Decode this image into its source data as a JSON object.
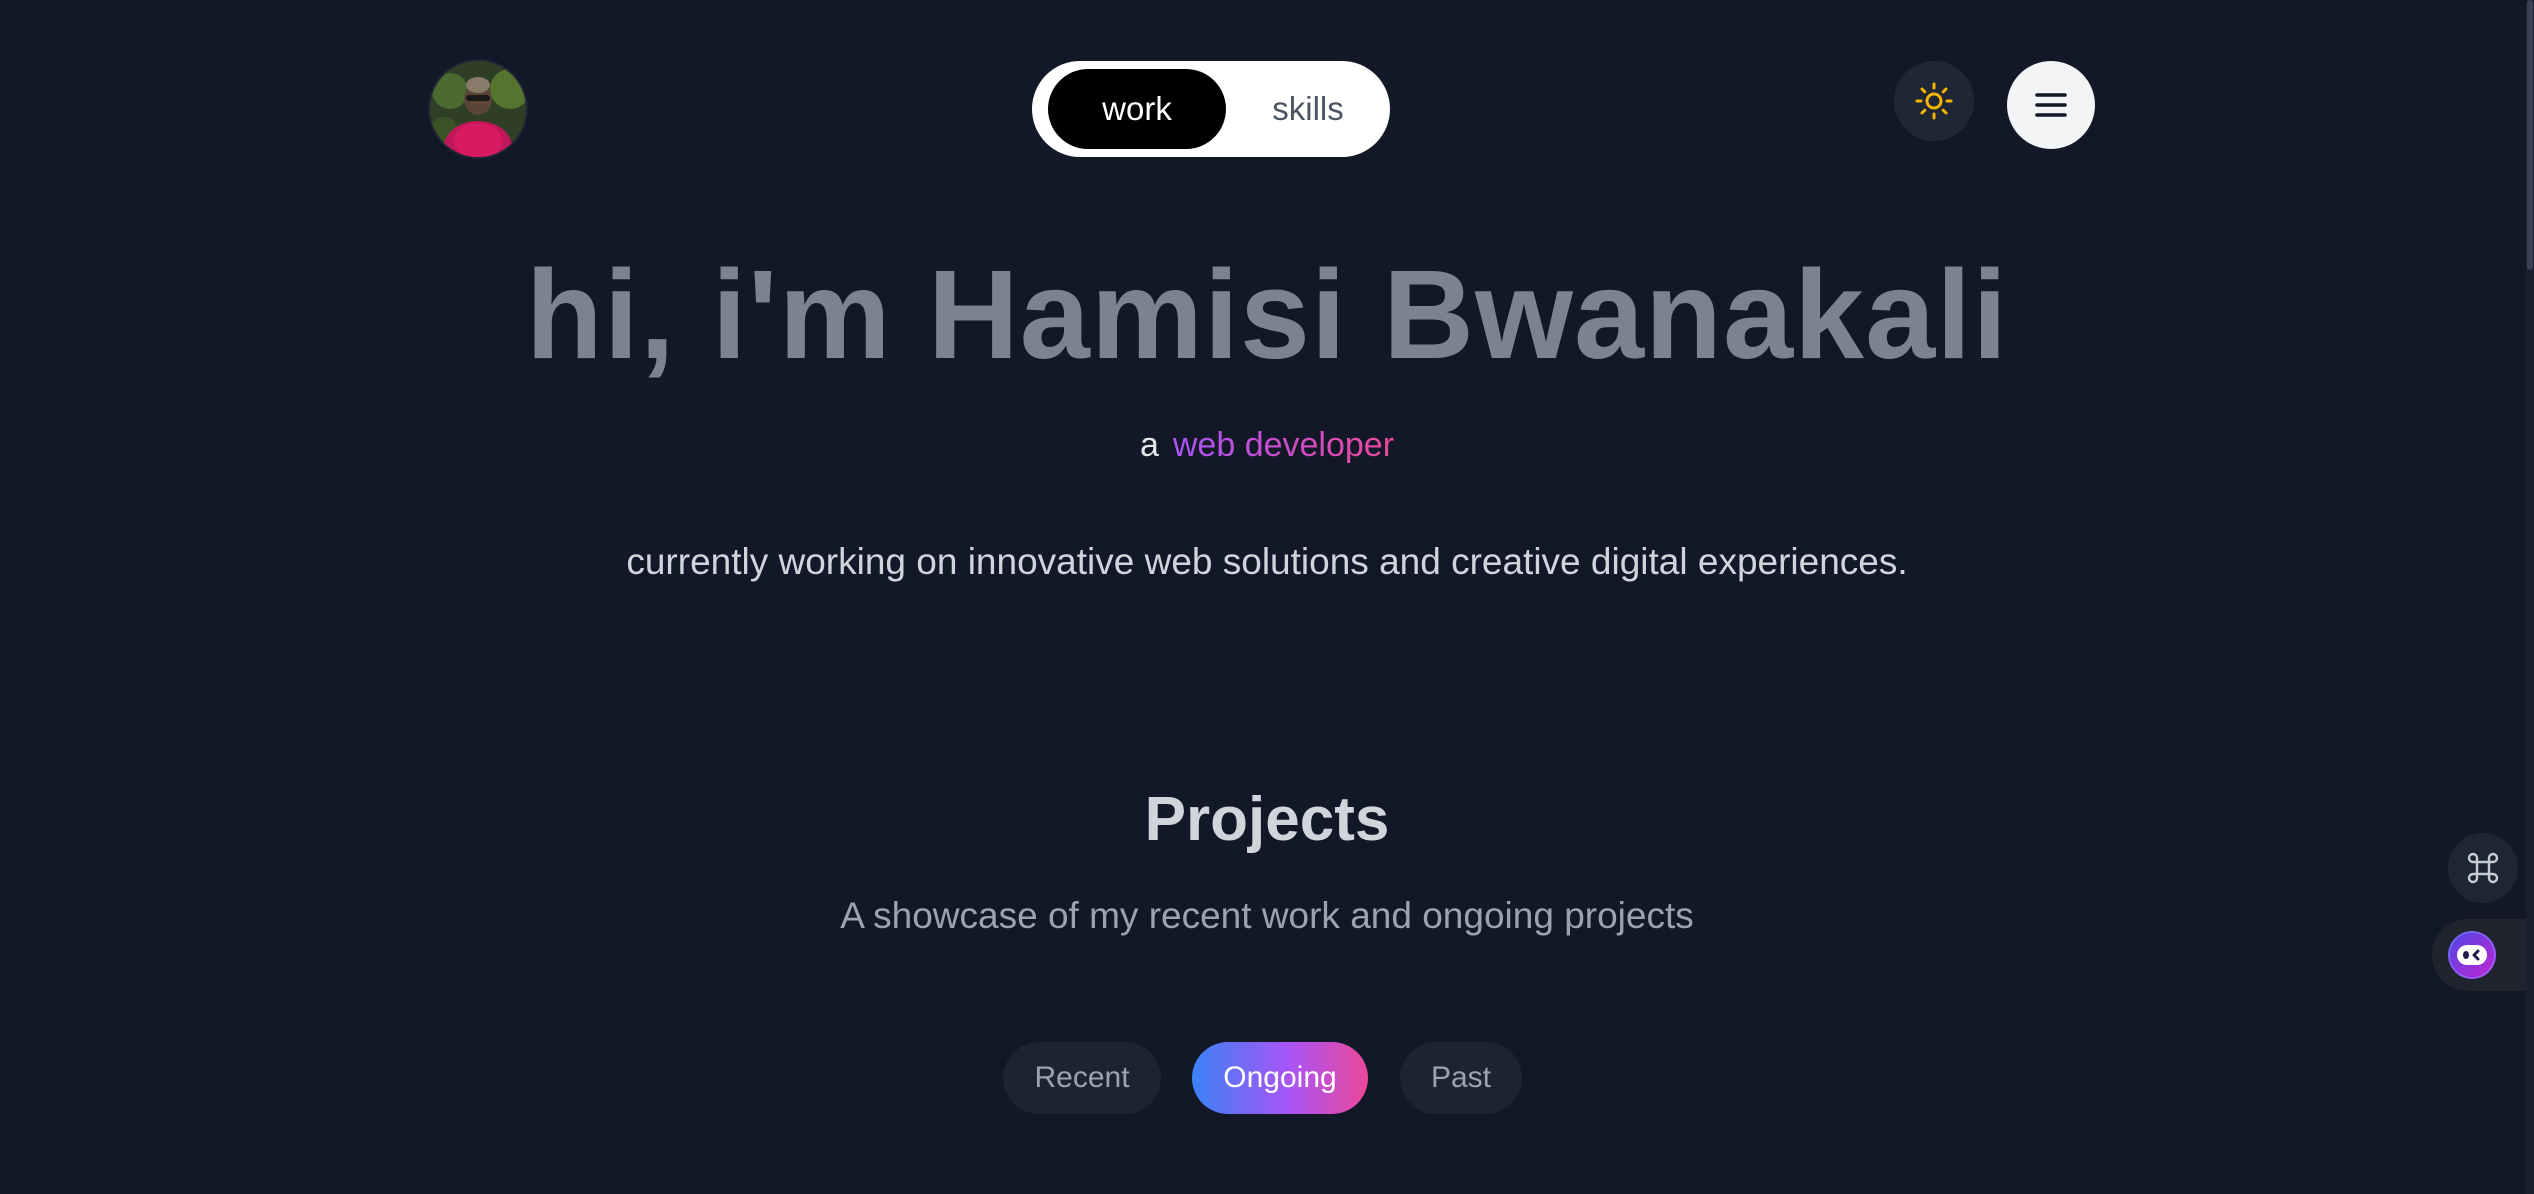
{
  "header": {
    "toggle": {
      "work_label": "work",
      "skills_label": "skills"
    }
  },
  "hero": {
    "title": "hi, i'm Hamisi Bwanakali",
    "prefix": "a",
    "role": "web developer",
    "description": "currently working on innovative web solutions and creative digital experiences."
  },
  "projects": {
    "title": "Projects",
    "subtitle": "A showcase of my recent work and ongoing projects",
    "tabs": [
      {
        "label": "Recent"
      },
      {
        "label": "Ongoing"
      },
      {
        "label": "Past"
      }
    ],
    "active_tab": "Ongoing"
  },
  "icons": {
    "avatar": "profile-photo",
    "theme": "sun-icon",
    "menu": "hamburger-menu-icon",
    "command": "command-key-icon",
    "chatbot": "chatbot-icon"
  },
  "colors": {
    "background": "#121828",
    "accent_gradient_start": "#3b82f6",
    "accent_gradient_mid": "#a855f7",
    "accent_gradient_end": "#ec4899",
    "sun": "#f5b400"
  }
}
